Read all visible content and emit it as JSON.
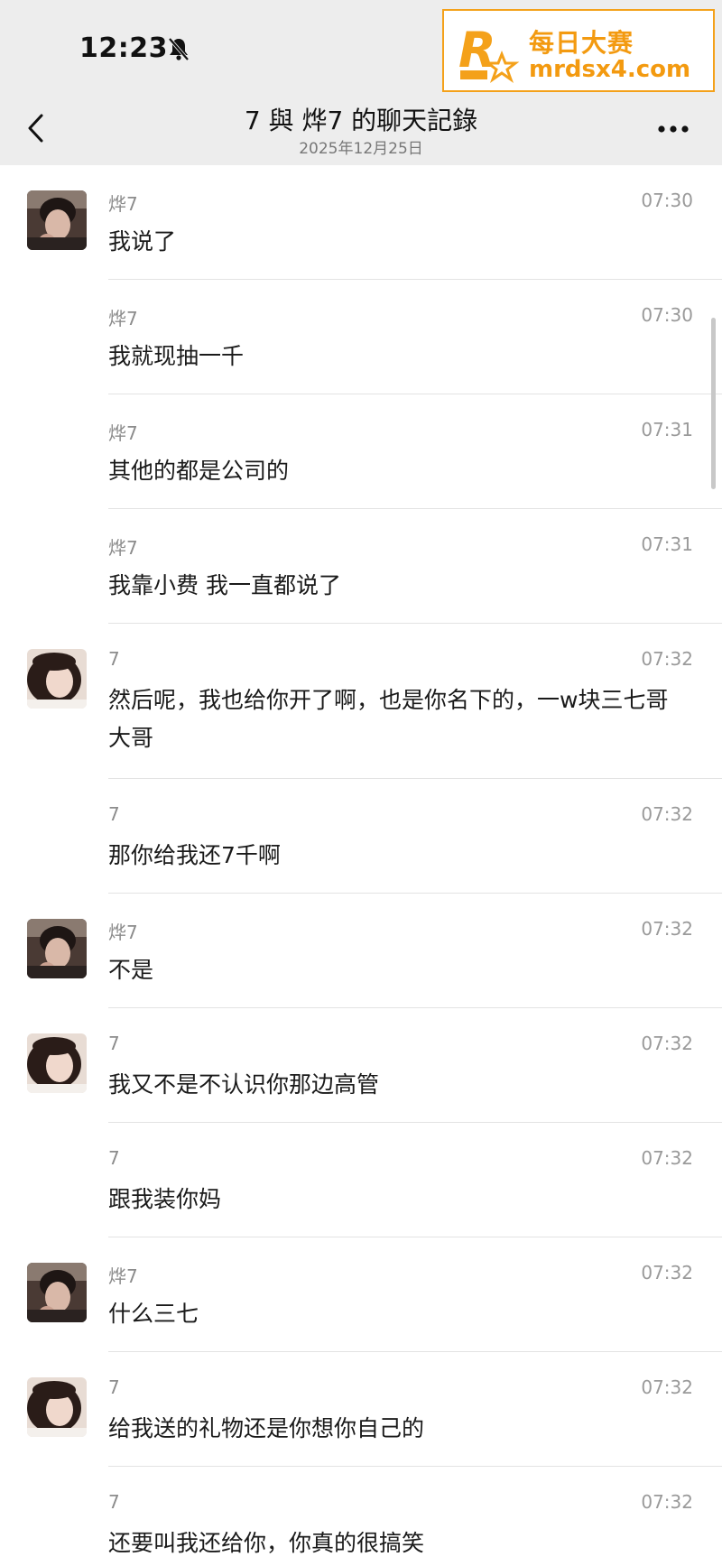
{
  "status_bar": {
    "time": "12:23"
  },
  "watermark": {
    "name": "每日大赛",
    "url": "mrdsx4.com"
  },
  "header": {
    "title": "7 與 烨7 的聊天記錄",
    "date": "2025年12月25日"
  },
  "messages": [
    {
      "sender": "烨7",
      "time": "07:30",
      "text": "我说了",
      "avatar": "male"
    },
    {
      "sender": "烨7",
      "time": "07:30",
      "text": "我就现抽一千",
      "avatar": ""
    },
    {
      "sender": "烨7",
      "time": "07:31",
      "text": "其他的都是公司的",
      "avatar": ""
    },
    {
      "sender": "烨7",
      "time": "07:31",
      "text": "我靠小费 我一直都说了",
      "avatar": ""
    },
    {
      "sender": "7",
      "time": "07:32",
      "text": "然后呢，我也给你开了啊，也是你名下的，一w块三七哥大哥",
      "avatar": "female"
    },
    {
      "sender": "7",
      "time": "07:32",
      "text": "那你给我还7千啊",
      "avatar": ""
    },
    {
      "sender": "烨7",
      "time": "07:32",
      "text": "不是",
      "avatar": "male"
    },
    {
      "sender": "7",
      "time": "07:32",
      "text": "我又不是不认识你那边高管",
      "avatar": "female"
    },
    {
      "sender": "7",
      "time": "07:32",
      "text": "跟我装你妈",
      "avatar": ""
    },
    {
      "sender": "烨7",
      "time": "07:32",
      "text": "什么三七",
      "avatar": "male"
    },
    {
      "sender": "7",
      "time": "07:32",
      "text": "给我送的礼物还是你想你自己的",
      "avatar": "female"
    },
    {
      "sender": "7",
      "time": "07:32",
      "text": "还要叫我还给你，你真的很搞笑",
      "avatar": ""
    }
  ],
  "colors": {
    "header_bg": "#ededed",
    "watermark_accent": "#f39a10",
    "divider": "#e3e3e3"
  }
}
